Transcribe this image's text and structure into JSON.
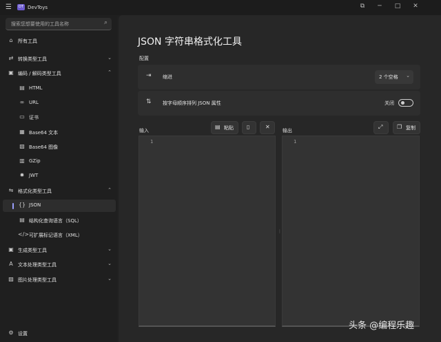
{
  "window": {
    "title": "DevToys",
    "logo_text": "DT",
    "controls": {
      "restore": "⧉",
      "minimize": "─",
      "maximize": "□",
      "close": "✕"
    }
  },
  "sidebar": {
    "search_placeholder": "搜索您想要使用的工具名称",
    "all_tools": "所有工具",
    "groups": [
      {
        "label": "转换类型工具",
        "chevron": "⌄"
      },
      {
        "label": "编码 / 解码类型工具",
        "chevron": "⌃"
      }
    ],
    "encode_items": [
      {
        "label": "HTML",
        "icon": "html-icon"
      },
      {
        "label": "URL",
        "icon": "link-icon"
      },
      {
        "label": "证书",
        "icon": "certificate-icon"
      },
      {
        "label": "Base64 文本",
        "icon": "base64-text-icon"
      },
      {
        "label": "Base64 图像",
        "icon": "base64-image-icon"
      },
      {
        "label": "GZip",
        "icon": "gzip-icon"
      },
      {
        "label": "JWT",
        "icon": "jwt-icon"
      }
    ],
    "format_group": {
      "label": "格式化类型工具",
      "chevron": "⌃"
    },
    "format_items": [
      {
        "label": "JSON",
        "icon": "json-icon",
        "selected": true
      },
      {
        "label": "结构化查询语言（SQL）",
        "icon": "sql-icon"
      },
      {
        "label": "可扩展标记语言（XML）",
        "icon": "xml-icon"
      }
    ],
    "more_groups": [
      {
        "label": "生成类型工具",
        "chevron": "⌄"
      },
      {
        "label": "文本处理类型工具",
        "chevron": "⌄"
      },
      {
        "label": "图片处理类型工具",
        "chevron": "⌄"
      }
    ],
    "settings": "设置"
  },
  "main": {
    "title": "JSON 字符串格式化工具",
    "config_label": "配置",
    "indent": {
      "label": "缩进",
      "value": "2 个空格"
    },
    "sort": {
      "label": "按字母顺序排列 JSON 属性",
      "toggle_label": "关闭",
      "on": false
    },
    "input": {
      "label": "输入",
      "paste": "粘贴",
      "line_number": "1"
    },
    "output": {
      "label": "输出",
      "copy": "复制",
      "line_number": "1"
    }
  },
  "watermark": "头条 @编程乐趣",
  "colors": {
    "accent": "#9ba0ff",
    "background": "#202020",
    "panel": "#2e2e2e"
  }
}
